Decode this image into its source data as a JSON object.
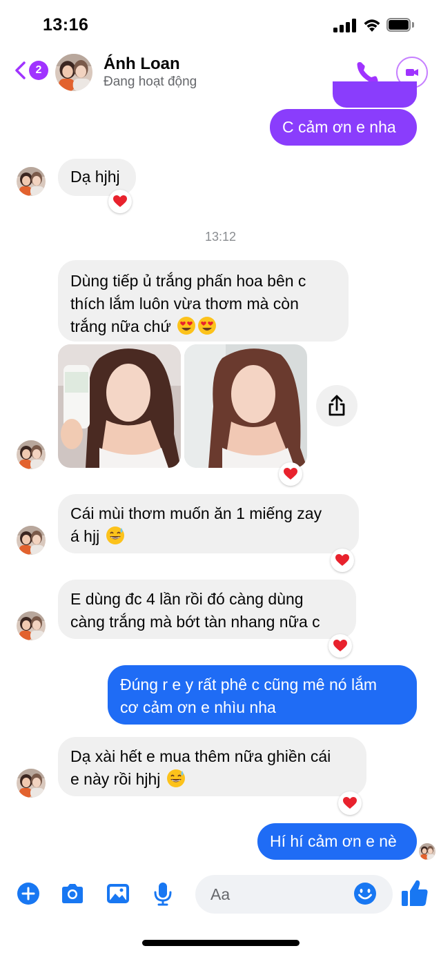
{
  "status_bar": {
    "time": "13:16"
  },
  "header": {
    "back_badge": "2",
    "contact_name": "Ánh Loan",
    "contact_status": "Đang hoạt động"
  },
  "messages": {
    "m1": "C cảm ơn e nha",
    "m2": "Dạ hjhj",
    "timestamp": "13:12",
    "m3": "Dùng tiếp ủ trắng phấn hoa bên c\nthích lắm luôn vừa thơm mà còn\ntrắng nữa chứ",
    "m4": "Cái mùi thơm muốn ăn 1 miếng zay\ná hjj",
    "m5": "E dùng đc 4 lần rồi đó càng dùng\ncàng trắng mà bớt tàn nhang nữa c",
    "m6": "Đúng r e y rất phê c cũng mê nó lắm\ncơ cảm ơn e nhìu nha",
    "m7": "Dạ xài hết e mua thêm nữa ghiền cái\ne này rồi hjhj",
    "m8": "Hí hí cảm ơn e nè"
  },
  "composer": {
    "placeholder": "Aa"
  },
  "icons": {
    "back": "chevron-left-icon",
    "call": "phone-icon",
    "video": "video-camera-icon",
    "share": "share-icon",
    "reaction": "heart-icon",
    "plus": "plus-circle-icon",
    "camera": "camera-icon",
    "gallery": "image-icon",
    "mic": "microphone-icon",
    "emoji": "smiley-icon",
    "like": "thumbs-up-icon"
  },
  "colors": {
    "accent_purple": "#8a3dfc",
    "accent_blue": "#1f6cf5",
    "messenger_blue": "#1877f2",
    "incoming_bubble": "#f0f0f0",
    "reaction_heart": "#e8222d"
  }
}
